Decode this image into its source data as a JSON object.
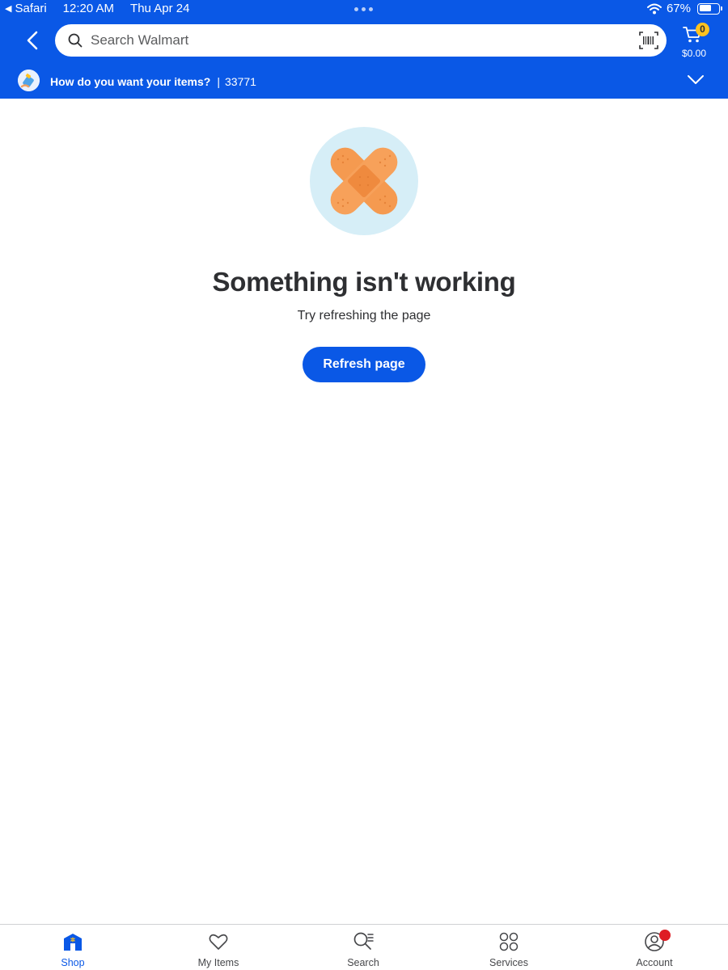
{
  "status_bar": {
    "back_app": "Safari",
    "time": "12:20 AM",
    "date": "Thu Apr 24",
    "battery": "67%",
    "battery_level": 0.67
  },
  "header": {
    "search_placeholder": "Search Walmart",
    "cart_count": "0",
    "cart_total": "$0.00"
  },
  "fulfillment": {
    "question": "How do you want your items?",
    "separator": "|",
    "zip": "33771"
  },
  "error": {
    "title": "Something isn't working",
    "subtitle": "Try refreshing the page",
    "button_label": "Refresh page"
  },
  "bottom_nav": {
    "items": [
      {
        "label": "Shop",
        "icon": "store-icon",
        "active": true
      },
      {
        "label": "My Items",
        "icon": "heart-icon"
      },
      {
        "label": "Search",
        "icon": "search-list-icon"
      },
      {
        "label": "Services",
        "icon": "grid-circles-icon"
      },
      {
        "label": "Account",
        "icon": "account-icon"
      }
    ]
  },
  "colors": {
    "brand_blue": "#0a58e6",
    "badge_yellow": "#ffc220",
    "notification_red": "#de1c24",
    "bandage_orange": "#f59a50",
    "illustration_bg": "#d6eef7"
  }
}
